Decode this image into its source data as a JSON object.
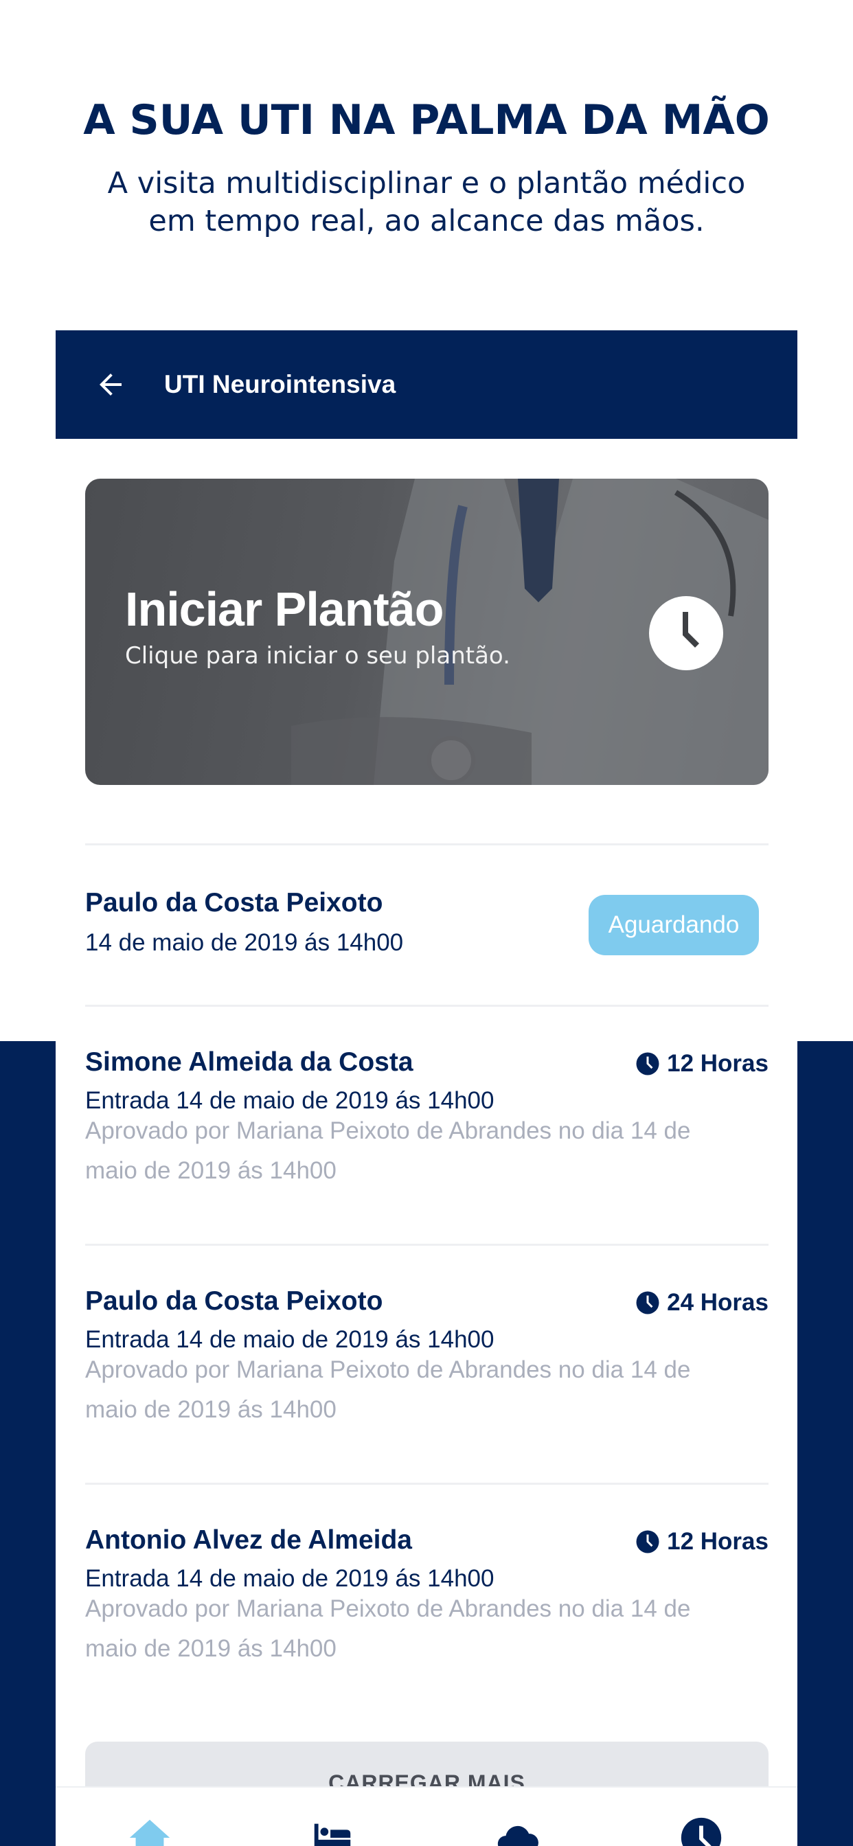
{
  "promo": {
    "headline": "A SUA UTI NA PALMA DA MÃO",
    "subline": "A visita multidisciplinar e o plantão médico em tempo real, ao alcance das mãos."
  },
  "appbar": {
    "title": "UTI Neurointensiva",
    "back_icon": "arrow-left-icon"
  },
  "hero": {
    "title": "Iniciar Plantão",
    "subtitle": "Clique para iniciar o seu plantão.",
    "icon": "clock-icon"
  },
  "pending": {
    "name": "Paulo da Costa Peixoto",
    "date": "14 de maio de 2019 ás 14h00",
    "status": "Aguardando",
    "status_color": "#7fcbee"
  },
  "shifts": [
    {
      "name": "Simone Almeida da Costa",
      "hours": "12 Horas",
      "entry": "Entrada 14 de maio de 2019 ás 14h00",
      "approved": "Aprovado por Mariana Peixoto de Abrandes no dia 14 de maio de 2019 ás 14h00"
    },
    {
      "name": "Paulo da Costa Peixoto",
      "hours": "24 Horas",
      "entry": "Entrada 14 de maio de 2019 ás 14h00",
      "approved": "Aprovado por Mariana Peixoto de Abrandes no dia 14 de maio de 2019 ás 14h00"
    },
    {
      "name": "Antonio Alvez de Almeida",
      "hours": "12 Horas",
      "entry": "Entrada 14 de maio de 2019 ás 14h00",
      "approved": "Aprovado por Mariana Peixoto de Abrandes no dia 14 de maio de 2019 ás 14h00"
    }
  ],
  "load_more": "CARREGAR MAIS",
  "tabbar": {
    "items": [
      "home-icon",
      "bed-icon",
      "cloud-icon",
      "clock-icon"
    ],
    "active_color": "#7fcbee",
    "inactive_color": "#022258"
  },
  "colors": {
    "navy": "#022258",
    "muted_text": "#a9aebb"
  }
}
